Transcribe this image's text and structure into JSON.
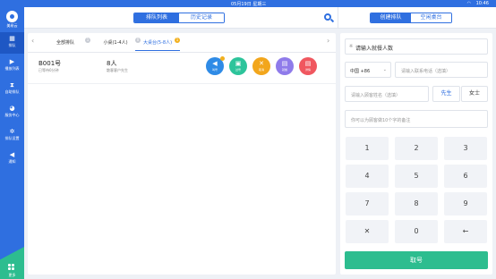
{
  "status_bar": {
    "date": "05月19日 星期三",
    "time": "10:46",
    "wifi_icon": "wifi-icon"
  },
  "sidebar": {
    "store_name": "美易云",
    "items": [
      {
        "label": "排队",
        "icon": "queue-icon"
      },
      {
        "label": "播放列表",
        "icon": "playlist-icon"
      },
      {
        "label": "自助排队",
        "icon": "hourglass-icon"
      },
      {
        "label": "服务中心",
        "icon": "service-icon"
      },
      {
        "label": "排队设置",
        "icon": "settings-icon"
      },
      {
        "label": "通知",
        "icon": "speaker-icon"
      }
    ],
    "bottom_label": "更多"
  },
  "header": {
    "tabs": [
      "排队列表",
      "历史记录"
    ],
    "right_tabs": [
      "创建排队",
      "空闲桌台"
    ]
  },
  "queue_tabs": [
    {
      "label": "全部排队",
      "badge": "1"
    },
    {
      "label": "小桌(1-4人)",
      "badge": "0"
    },
    {
      "label": "大桌台(5-8人)",
      "badge": "1"
    }
  ],
  "queue_row": {
    "number": "B001号",
    "wait": "已等待0分钟",
    "people": "8人",
    "customer": "散客客户先生",
    "actions": [
      "叫号",
      "过号",
      "取消",
      "就餐",
      "详情"
    ]
  },
  "form": {
    "party_placeholder": "请输入就餐人数",
    "country_code": "中国 +86",
    "phone_placeholder": "请输入联系电话（选填）",
    "name_placeholder": "请输入顾客姓名（选填）",
    "gender_male": "先生",
    "gender_female": "女士",
    "note_placeholder": "你可以为顾客做10个字的备注"
  },
  "keypad": [
    "1",
    "2",
    "3",
    "4",
    "5",
    "6",
    "7",
    "8",
    "9",
    "✕",
    "0",
    "←"
  ],
  "submit_label": "取号",
  "colors": {
    "primary": "#2f6fe0",
    "green": "#2dbd8f"
  }
}
